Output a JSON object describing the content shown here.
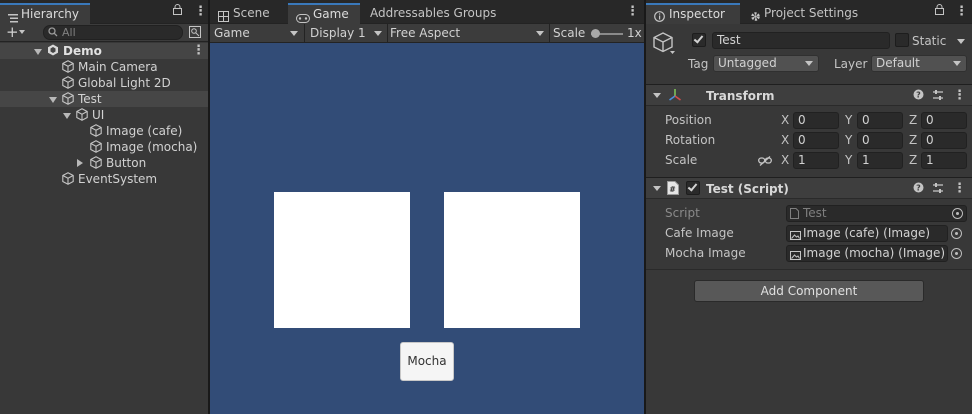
{
  "hierarchy": {
    "tab_label": "Hierarchy",
    "search_placeholder": "All",
    "rows": [
      {
        "label": "Demo",
        "indent": 0,
        "expanded": true,
        "kind": "scene"
      },
      {
        "label": "Main Camera",
        "indent": 1
      },
      {
        "label": "Global Light 2D",
        "indent": 1
      },
      {
        "label": "Test",
        "indent": 1,
        "expanded": true,
        "selected": true
      },
      {
        "label": "UI",
        "indent": 2,
        "expanded": true
      },
      {
        "label": "Image (cafe)",
        "indent": 3
      },
      {
        "label": "Image (mocha)",
        "indent": 3
      },
      {
        "label": "Button",
        "indent": 3,
        "collapsed": true
      },
      {
        "label": "EventSystem",
        "indent": 1
      }
    ]
  },
  "game": {
    "tabs": [
      "Scene",
      "Game",
      "Addressables Groups"
    ],
    "active_tab": "Game",
    "toolbar": {
      "view": "Game",
      "display": "Display 1",
      "aspect": "Free Aspect",
      "scale_label": "Scale",
      "scale_value": "1x"
    },
    "button_label": "Mocha",
    "colors": {
      "viewport": "#324c77",
      "image": "#ffffff"
    }
  },
  "inspector": {
    "tabs": [
      "Inspector",
      "Project Settings"
    ],
    "active_tab": "Inspector",
    "object": {
      "name": "Test",
      "active": true,
      "static_label": "Static",
      "tag_label": "Tag",
      "tag_value": "Untagged",
      "layer_label": "Layer",
      "layer_value": "Default"
    },
    "transform": {
      "title": "Transform",
      "position": {
        "label": "Position",
        "x": "0",
        "y": "0",
        "z": "0"
      },
      "rotation": {
        "label": "Rotation",
        "x": "0",
        "y": "0",
        "z": "0"
      },
      "scale": {
        "label": "Scale",
        "x": "1",
        "y": "1",
        "z": "1"
      }
    },
    "script": {
      "title": "Test (Script)",
      "enabled": true,
      "fields": [
        {
          "label": "Script",
          "value": "Test"
        },
        {
          "label": "Cafe Image",
          "value": "Image (cafe) (Image)"
        },
        {
          "label": "Mocha Image",
          "value": "Image (mocha) (Image)"
        }
      ]
    },
    "add_component_label": "Add Component"
  }
}
